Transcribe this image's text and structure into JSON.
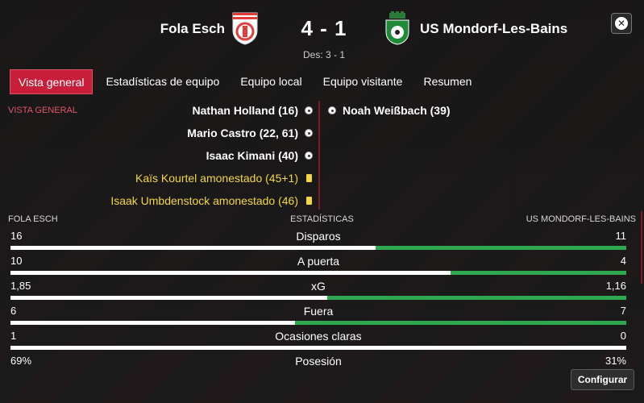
{
  "match": {
    "home_team": "Fola Esch",
    "away_team": "US Mondorf-Les-Bains",
    "score": "4 - 1",
    "halftime": "Des: 3 - 1"
  },
  "tabs": [
    {
      "label": "Vista general",
      "active": true
    },
    {
      "label": "Estadísticas de equipo",
      "active": false
    },
    {
      "label": "Equipo local",
      "active": false
    },
    {
      "label": "Equipo visitante",
      "active": false
    },
    {
      "label": "Resumen",
      "active": false
    }
  ],
  "overview_label": "VISTA GENERAL",
  "home_events": [
    {
      "text": "Nathan Holland (16)",
      "type": "goal"
    },
    {
      "text": "Mario Castro (22, 61)",
      "type": "goal"
    },
    {
      "text": "Isaac Kimani (40)",
      "type": "goal"
    },
    {
      "text": "Kaïs Kourtel amonestado (45+1)",
      "type": "yellow"
    },
    {
      "text": "Isaak Umbdenstock amonestado (46)",
      "type": "yellow"
    }
  ],
  "away_events": [
    {
      "text": "Noah Weißbach (39)",
      "type": "goal"
    }
  ],
  "stats_header": {
    "home": "FOLA ESCH",
    "center": "ESTADÍSTICAS",
    "away": "US MONDORF-LES-BAINS"
  },
  "stats": [
    {
      "label": "Disparos",
      "home": "16",
      "away": "11",
      "home_share": 0.593
    },
    {
      "label": "A puerta",
      "home": "10",
      "away": "4",
      "home_share": 0.714
    },
    {
      "label": "xG",
      "home": "1,85",
      "away": "1,16",
      "home_share": 0.515
    },
    {
      "label": "Fuera",
      "home": "6",
      "away": "7",
      "home_share": 0.462
    },
    {
      "label": "Ocasiones claras",
      "home": "1",
      "away": "0",
      "home_share": 1.0
    },
    {
      "label": "Posesión",
      "home": "69%",
      "away": "31%",
      "home_share": null
    }
  ],
  "buttons": {
    "configure": "Configurar"
  },
  "colors": {
    "accent": "#c81e3a",
    "home_bar": "#ffffff",
    "away_bar": "#2fa84f",
    "card": "#f2d840"
  }
}
